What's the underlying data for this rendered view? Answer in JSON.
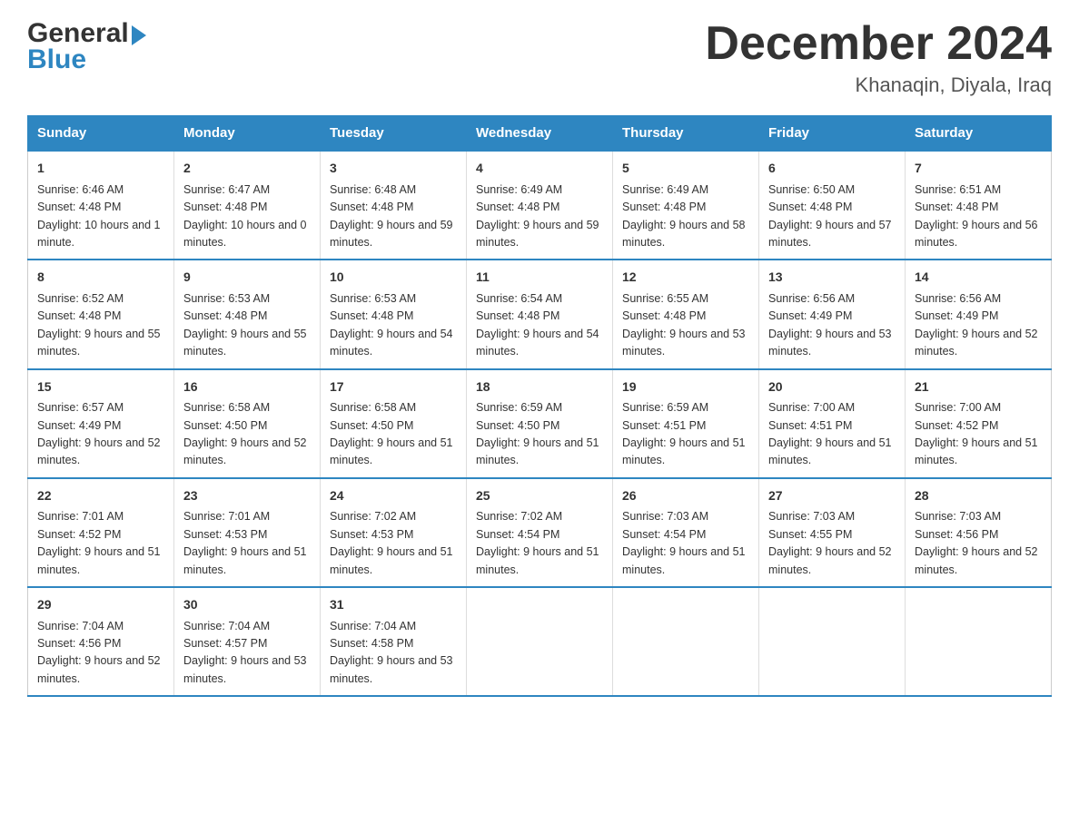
{
  "header": {
    "logo_general": "General",
    "logo_blue": "Blue",
    "month_title": "December 2024",
    "location": "Khanaqin, Diyala, Iraq"
  },
  "days_of_week": [
    "Sunday",
    "Monday",
    "Tuesday",
    "Wednesday",
    "Thursday",
    "Friday",
    "Saturday"
  ],
  "weeks": [
    [
      {
        "day": "1",
        "sunrise": "6:46 AM",
        "sunset": "4:48 PM",
        "daylight": "10 hours and 1 minute."
      },
      {
        "day": "2",
        "sunrise": "6:47 AM",
        "sunset": "4:48 PM",
        "daylight": "10 hours and 0 minutes."
      },
      {
        "day": "3",
        "sunrise": "6:48 AM",
        "sunset": "4:48 PM",
        "daylight": "9 hours and 59 minutes."
      },
      {
        "day": "4",
        "sunrise": "6:49 AM",
        "sunset": "4:48 PM",
        "daylight": "9 hours and 59 minutes."
      },
      {
        "day": "5",
        "sunrise": "6:49 AM",
        "sunset": "4:48 PM",
        "daylight": "9 hours and 58 minutes."
      },
      {
        "day": "6",
        "sunrise": "6:50 AM",
        "sunset": "4:48 PM",
        "daylight": "9 hours and 57 minutes."
      },
      {
        "day": "7",
        "sunrise": "6:51 AM",
        "sunset": "4:48 PM",
        "daylight": "9 hours and 56 minutes."
      }
    ],
    [
      {
        "day": "8",
        "sunrise": "6:52 AM",
        "sunset": "4:48 PM",
        "daylight": "9 hours and 55 minutes."
      },
      {
        "day": "9",
        "sunrise": "6:53 AM",
        "sunset": "4:48 PM",
        "daylight": "9 hours and 55 minutes."
      },
      {
        "day": "10",
        "sunrise": "6:53 AM",
        "sunset": "4:48 PM",
        "daylight": "9 hours and 54 minutes."
      },
      {
        "day": "11",
        "sunrise": "6:54 AM",
        "sunset": "4:48 PM",
        "daylight": "9 hours and 54 minutes."
      },
      {
        "day": "12",
        "sunrise": "6:55 AM",
        "sunset": "4:48 PM",
        "daylight": "9 hours and 53 minutes."
      },
      {
        "day": "13",
        "sunrise": "6:56 AM",
        "sunset": "4:49 PM",
        "daylight": "9 hours and 53 minutes."
      },
      {
        "day": "14",
        "sunrise": "6:56 AM",
        "sunset": "4:49 PM",
        "daylight": "9 hours and 52 minutes."
      }
    ],
    [
      {
        "day": "15",
        "sunrise": "6:57 AM",
        "sunset": "4:49 PM",
        "daylight": "9 hours and 52 minutes."
      },
      {
        "day": "16",
        "sunrise": "6:58 AM",
        "sunset": "4:50 PM",
        "daylight": "9 hours and 52 minutes."
      },
      {
        "day": "17",
        "sunrise": "6:58 AM",
        "sunset": "4:50 PM",
        "daylight": "9 hours and 51 minutes."
      },
      {
        "day": "18",
        "sunrise": "6:59 AM",
        "sunset": "4:50 PM",
        "daylight": "9 hours and 51 minutes."
      },
      {
        "day": "19",
        "sunrise": "6:59 AM",
        "sunset": "4:51 PM",
        "daylight": "9 hours and 51 minutes."
      },
      {
        "day": "20",
        "sunrise": "7:00 AM",
        "sunset": "4:51 PM",
        "daylight": "9 hours and 51 minutes."
      },
      {
        "day": "21",
        "sunrise": "7:00 AM",
        "sunset": "4:52 PM",
        "daylight": "9 hours and 51 minutes."
      }
    ],
    [
      {
        "day": "22",
        "sunrise": "7:01 AM",
        "sunset": "4:52 PM",
        "daylight": "9 hours and 51 minutes."
      },
      {
        "day": "23",
        "sunrise": "7:01 AM",
        "sunset": "4:53 PM",
        "daylight": "9 hours and 51 minutes."
      },
      {
        "day": "24",
        "sunrise": "7:02 AM",
        "sunset": "4:53 PM",
        "daylight": "9 hours and 51 minutes."
      },
      {
        "day": "25",
        "sunrise": "7:02 AM",
        "sunset": "4:54 PM",
        "daylight": "9 hours and 51 minutes."
      },
      {
        "day": "26",
        "sunrise": "7:03 AM",
        "sunset": "4:54 PM",
        "daylight": "9 hours and 51 minutes."
      },
      {
        "day": "27",
        "sunrise": "7:03 AM",
        "sunset": "4:55 PM",
        "daylight": "9 hours and 52 minutes."
      },
      {
        "day": "28",
        "sunrise": "7:03 AM",
        "sunset": "4:56 PM",
        "daylight": "9 hours and 52 minutes."
      }
    ],
    [
      {
        "day": "29",
        "sunrise": "7:04 AM",
        "sunset": "4:56 PM",
        "daylight": "9 hours and 52 minutes."
      },
      {
        "day": "30",
        "sunrise": "7:04 AM",
        "sunset": "4:57 PM",
        "daylight": "9 hours and 53 minutes."
      },
      {
        "day": "31",
        "sunrise": "7:04 AM",
        "sunset": "4:58 PM",
        "daylight": "9 hours and 53 minutes."
      },
      null,
      null,
      null,
      null
    ]
  ],
  "labels": {
    "sunrise": "Sunrise:",
    "sunset": "Sunset:",
    "daylight": "Daylight:"
  }
}
